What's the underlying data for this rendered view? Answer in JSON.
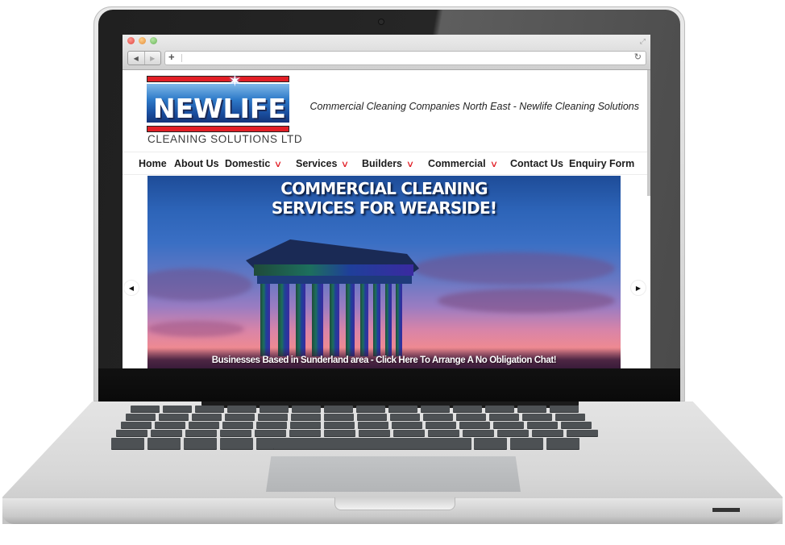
{
  "browser": {
    "address_value": "",
    "buttons": {
      "back": "◀",
      "forward": "▶",
      "new_tab": "+",
      "reload": "↻",
      "fullscreen": "⤢"
    }
  },
  "site": {
    "logo": {
      "brand": "NEWLIFE",
      "subtitle": "CLEANING SOLUTIONS LTD"
    },
    "tagline": "Commercial Cleaning Companies North East - Newlife Cleaning Solutions",
    "nav": [
      {
        "label": "Home",
        "has_dropdown": false
      },
      {
        "label": "About Us",
        "has_dropdown": false
      },
      {
        "label": "Domestic",
        "has_dropdown": true
      },
      {
        "label": "Services",
        "has_dropdown": true
      },
      {
        "label": "Builders",
        "has_dropdown": true
      },
      {
        "label": "Commercial",
        "has_dropdown": true
      },
      {
        "label": "Contact Us",
        "has_dropdown": false
      },
      {
        "label": "Enquiry Form",
        "has_dropdown": false
      }
    ],
    "dropdown_glyph": "⌄",
    "hero": {
      "title_line1": "COMMERCIAL CLEANING",
      "title_line2": "SERVICES FOR WEARSIDE!",
      "cta": "Businesses Based  in Sunderland area - Click Here To Arrange A No Obligation Chat!"
    },
    "slider": {
      "prev": "◀",
      "next": "▶"
    },
    "colors": {
      "accent_red": "#e21f26",
      "logo_blue": "#1a4fa0",
      "nav_text": "#1c1c1c"
    }
  }
}
